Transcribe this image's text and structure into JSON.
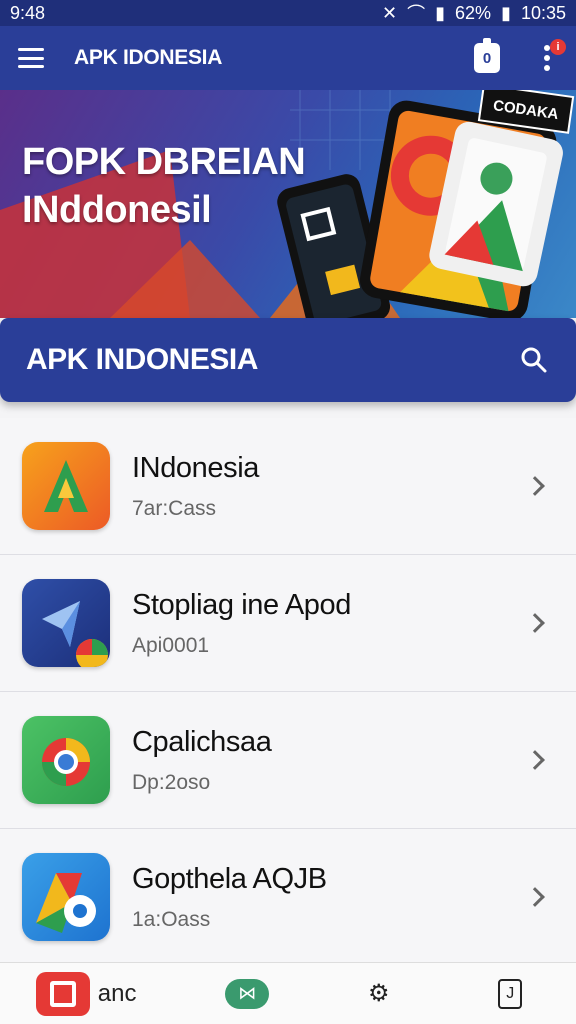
{
  "status": {
    "time": "9:48",
    "battery": "62%",
    "clock": "10:35"
  },
  "appbar": {
    "title": "APK IDONESIA",
    "badge_value": "0",
    "notif_count": "i"
  },
  "banner": {
    "line1": "FOPK DBREIAN",
    "line2": "INddonesil",
    "tag": "CODAKA"
  },
  "searchbar": {
    "title": "APK INDONESIA"
  },
  "apps": [
    {
      "title": "INdonesia",
      "subtitle": "7ar:Cass"
    },
    {
      "title": "Stopliag ine Apod",
      "subtitle": "Api0001"
    },
    {
      "title": "Cpalichsaa",
      "subtitle": "Dp:2oso"
    },
    {
      "title": "Gopthela AQJB",
      "subtitle": "1a:Oass"
    }
  ],
  "bottomnav": {
    "first_label": "anc"
  },
  "colors": {
    "primary": "#2a3e98",
    "status": "#1f2f7a",
    "accent_red": "#e53935"
  }
}
